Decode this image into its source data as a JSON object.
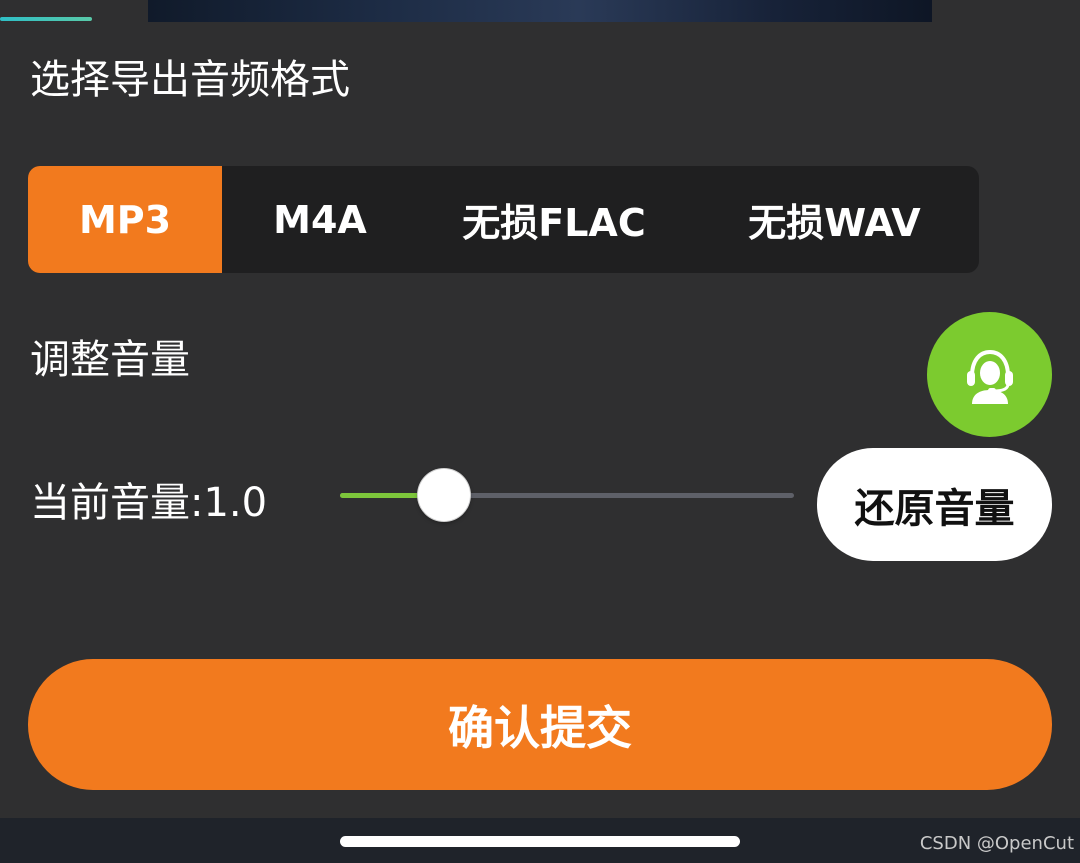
{
  "export_format": {
    "title": "选择导出音频格式",
    "options": [
      "MP3",
      "M4A",
      "无损FLAC",
      "无损WAV"
    ],
    "selected": "MP3"
  },
  "volume": {
    "title": "调整音量",
    "current_label": "当前音量:1.0",
    "slider_level_fraction": 0.23,
    "reset_label": "还原音量"
  },
  "support": {
    "icon": "customer-service-headset-icon"
  },
  "confirm": {
    "label": "确认提交"
  },
  "watermark": "CSDN @OpenCut",
  "colors": {
    "accent": "#f27a1e",
    "background": "#2f2f30",
    "segment_background": "#1f1f20",
    "slider_fill": "#7dc63b",
    "slider_track": "#5e6068",
    "support_button": "#7ccb2f",
    "tab_indicator": "#2fbfc6"
  }
}
